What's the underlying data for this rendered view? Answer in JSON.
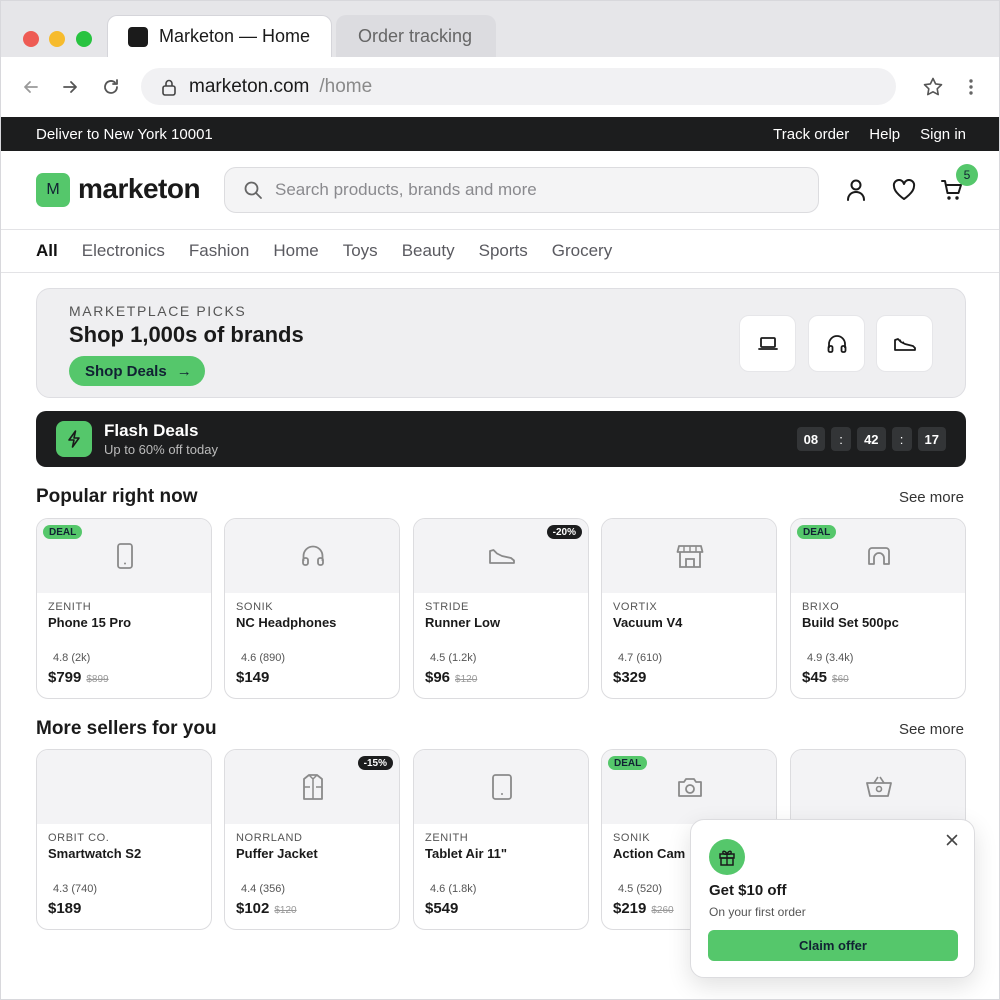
{
  "browser": {
    "tabs": [
      {
        "label": "Marketon — Home"
      },
      {
        "label": "Order tracking"
      }
    ],
    "url_host": "marketon.com",
    "url_path": "/home"
  },
  "topbar": {
    "deliver": "Deliver to New York 10001",
    "links": [
      "Track order",
      "Help",
      "Sign in"
    ]
  },
  "header": {
    "logo_mark": "M",
    "logo_text": "marketon",
    "search_placeholder": "Search products, brands and more",
    "cart_count": "5"
  },
  "categories": [
    "All",
    "Electronics",
    "Fashion",
    "Home",
    "Toys",
    "Beauty",
    "Sports",
    "Grocery"
  ],
  "hero": {
    "eyebrow": "MARKETPLACE PICKS",
    "headline": "Shop 1,000s of brands",
    "cta": "Shop Deals",
    "cta_arrow": "→",
    "tiles": [
      "laptop-icon",
      "headphones-icon",
      "sneaker-icon"
    ]
  },
  "flash": {
    "title": "Flash Deals",
    "subtitle": "Up to 60% off today",
    "hours": "08",
    "minutes": "42",
    "seconds": "17",
    "separator": ":"
  },
  "popular": {
    "title": "Popular right now",
    "see_more": "See more",
    "items": [
      {
        "badge": "DEAL",
        "brand": "ZENITH",
        "name": "Phone 15 Pro",
        "rating": "4.8 (2k)",
        "price": "$799",
        "old": "$899",
        "icon": "phone-icon"
      },
      {
        "badge": "",
        "brand": "SONIK",
        "name": "NC Headphones",
        "rating": "4.6 (890)",
        "price": "$149",
        "old": "",
        "icon": "headphones-icon"
      },
      {
        "badge": "-20%",
        "brand": "STRIDE",
        "name": "Runner Low",
        "rating": "4.5 (1.2k)",
        "price": "$96",
        "old": "$120",
        "icon": "sneaker-icon"
      },
      {
        "badge": "",
        "brand": "VORTIX",
        "name": "Vacuum V4",
        "rating": "4.7 (610)",
        "price": "$329",
        "old": "",
        "icon": "store-icon"
      },
      {
        "badge": "DEAL",
        "brand": "BRIXO",
        "name": "Build Set 500pc",
        "rating": "4.9 (3.4k)",
        "price": "$45",
        "old": "$60",
        "icon": "arch-icon"
      }
    ]
  },
  "sellers": {
    "title": "More sellers for you",
    "see_more": "See more",
    "items": [
      {
        "badge": "",
        "brand": "ORBIT CO.",
        "name": "Smartwatch S2",
        "rating": "4.3 (740)",
        "price": "$189",
        "old": "",
        "icon": ""
      },
      {
        "badge": "-15%",
        "brand": "NORRLAND",
        "name": "Puffer Jacket",
        "rating": "4.4 (356)",
        "price": "$102",
        "old": "$120",
        "icon": "jacket-icon"
      },
      {
        "badge": "",
        "brand": "ZENITH",
        "name": "Tablet Air 11\"",
        "rating": "4.6 (1.8k)",
        "price": "$549",
        "old": "",
        "icon": "tablet-icon"
      },
      {
        "badge": "DEAL",
        "brand": "SONIK",
        "name": "Action Cam",
        "rating": "4.5 (520)",
        "price": "$219",
        "old": "$260",
        "icon": "camera-icon"
      },
      {
        "badge": "",
        "brand": "",
        "name": "",
        "rating": "",
        "price": "",
        "old": "",
        "icon": "basket-icon"
      }
    ]
  },
  "popup": {
    "title": "Get $10 off",
    "subtitle": "On your first order",
    "button": "Claim offer"
  },
  "colors": {
    "accent": "#55c76b",
    "dark": "#1c1d1e"
  }
}
